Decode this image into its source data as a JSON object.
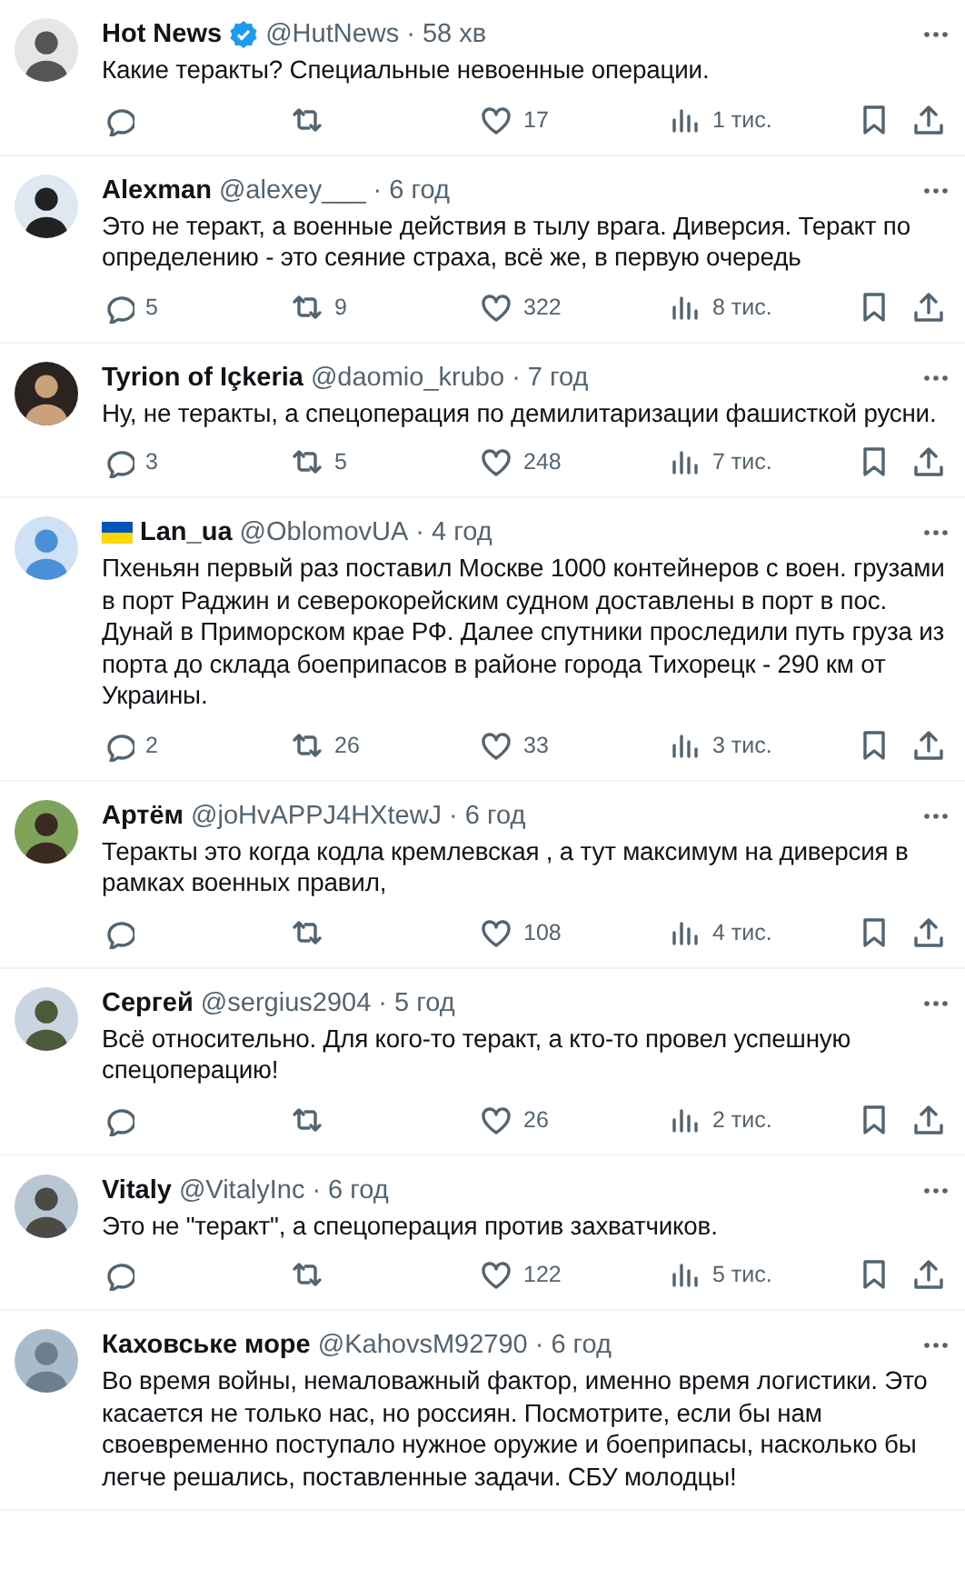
{
  "tweets": [
    {
      "name": "Hot News",
      "verified": true,
      "flag": false,
      "handle": "@HutNews",
      "time": "· 58 хв",
      "text": "Какие теракты? Специальные невоенные операции.",
      "actions": {
        "likes": "17",
        "views": "1 тис."
      }
    },
    {
      "name": "Alexman",
      "verified": false,
      "flag": false,
      "handle": "@alexey___",
      "time": "· 6 год",
      "text": "Это не теракт, а военные действия в тылу врага. Диверсия. Теракт по определению - это сеяние страха, всё же, в первую очередь",
      "actions": {
        "replies": "5",
        "reposts": "9",
        "likes": "322",
        "views": "8 тис."
      }
    },
    {
      "name": "Tyrion of Içkeria",
      "verified": false,
      "flag": false,
      "handle": "@daomio_krubo",
      "time": "· 7 год",
      "text": "Ну, не теракты, а спецоперация по демилитаризации фашисткой русни.",
      "actions": {
        "replies": "3",
        "reposts": "5",
        "likes": "248",
        "views": "7 тис."
      }
    },
    {
      "name": "Lan_ua",
      "verified": false,
      "flag": true,
      "handle": "@OblomovUA",
      "time": "· 4 год",
      "text": "Пхеньян первый раз поставил Москве 1000 контейнеров с воен. грузами в порт Раджин и северокорейским судном доставлены в порт в пос. Дунай в Приморском крае РФ. Далее спутники проследили путь груза из порта до склада боеприпасов в районе города Тихорецк - 290 км от Украины.",
      "actions": {
        "replies": "2",
        "reposts": "26",
        "likes": "33",
        "views": "3 тис."
      }
    },
    {
      "name": "Артём",
      "verified": false,
      "flag": false,
      "handle": "@joHvAPPJ4HXtewJ",
      "time": "· 6 год",
      "text": "Теракты это когда кодла кремлевская ,  а тут максимум на диверсия в рамках военных правил,",
      "actions": {
        "likes": "108",
        "views": "4 тис."
      }
    },
    {
      "name": "Сергей",
      "verified": false,
      "flag": false,
      "handle": "@sergius2904",
      "time": "· 5 год",
      "text": "Всё относительно. Для кого-то теракт, а кто-то провел успешную спецоперацию!",
      "actions": {
        "likes": "26",
        "views": "2 тис."
      }
    },
    {
      "name": "Vitaly",
      "verified": false,
      "flag": false,
      "handle": "@VitalyInc",
      "time": "· 6 год",
      "text": "Это не \"теракт\", а спецоперация против захватчиков.",
      "actions": {
        "likes": "122",
        "views": "5 тис."
      }
    },
    {
      "name": "Каховське море",
      "verified": false,
      "flag": false,
      "handle": "@KahovsM92790",
      "time": "· 6 год",
      "text": "Во время войны, немаловажный фактор, именно время логистики. Это касается не только нас, но россиян. Посмотрите, если бы нам своевременно поступало нужное оружие и боеприпасы, насколько бы легче решались, поставленные задачи. СБУ молодцы!"
    }
  ]
}
